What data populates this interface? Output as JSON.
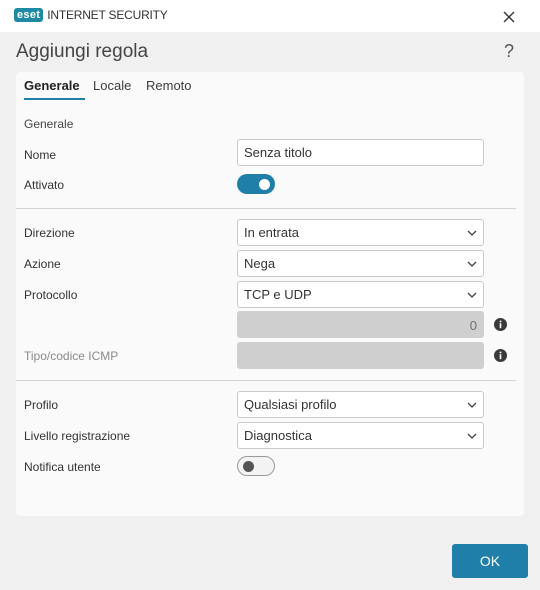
{
  "window": {
    "logo_text": "eset",
    "product": "INTERNET SECURITY"
  },
  "dialog": {
    "title": "Aggiungi regola",
    "help_glyph": "?"
  },
  "tabs": [
    {
      "label": "Generale",
      "active": true
    },
    {
      "label": "Locale",
      "active": false
    },
    {
      "label": "Remoto",
      "active": false
    }
  ],
  "form": {
    "section_heading": "Generale",
    "name_label": "Nome",
    "name_value": "Senza titolo",
    "enabled_label": "Attivato",
    "enabled": true,
    "direction_label": "Direzione",
    "direction_value": "In entrata",
    "action_label": "Azione",
    "action_value": "Nega",
    "protocol_label": "Protocollo",
    "protocol_value": "TCP e UDP",
    "protocol_number": "0",
    "icmp_label": "Tipo/codice ICMP",
    "icmp_value": "",
    "profile_label": "Profilo",
    "profile_value": "Qualsiasi profilo",
    "log_label": "Livello registrazione",
    "log_value": "Diagnostica",
    "notify_label": "Notifica utente",
    "notify": false
  },
  "buttons": {
    "ok": "OK"
  },
  "colors": {
    "accent": "#1f7fa8",
    "disabled_field": "#cfcfcf"
  }
}
